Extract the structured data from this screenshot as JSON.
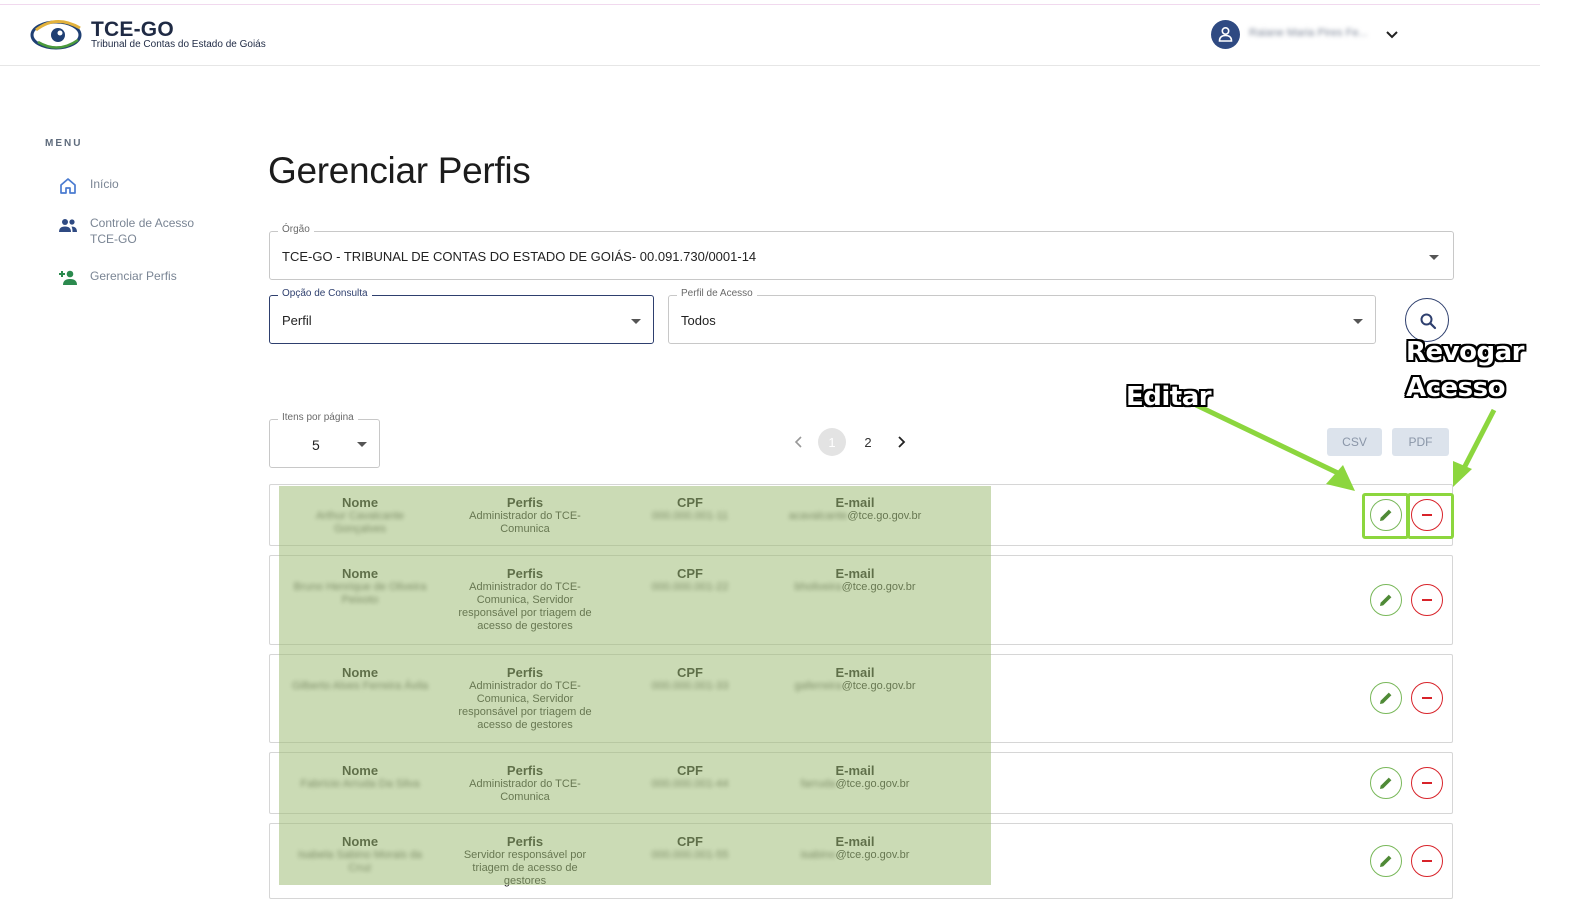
{
  "header": {
    "brand_title": "TCE-GO",
    "brand_subtitle": "Tribunal de Contas do Estado de Goiás",
    "user_name": "Raiane Maria Pires Fe..."
  },
  "menu": {
    "title": "MENU",
    "items": [
      {
        "label": "Início",
        "icon": "home-icon"
      },
      {
        "label": "Controle de Acesso TCE-GO",
        "icon": "people-icon"
      },
      {
        "label": "Gerenciar Perfis",
        "icon": "person-add-icon"
      }
    ]
  },
  "page": {
    "title": "Gerenciar Perfis"
  },
  "filters": {
    "orgao": {
      "label": "Órgão",
      "value": "TCE-GO - TRIBUNAL DE CONTAS DO ESTADO DE GOIÁS- 00.091.730/0001-14"
    },
    "opcao": {
      "label": "Opção de Consulta",
      "value": "Perfil"
    },
    "perfil": {
      "label": "Perfil de Acesso",
      "value": "Todos"
    }
  },
  "pagination": {
    "items_label": "Itens por página",
    "items_value": "5",
    "pages": [
      "1",
      "2"
    ],
    "current": "1"
  },
  "export": {
    "csv": "CSV",
    "pdf": "PDF"
  },
  "columns": {
    "nome": "Nome",
    "perfis": "Perfis",
    "cpf": "CPF",
    "email": "E-mail"
  },
  "rows": [
    {
      "nome": "Arthur Cavalcante Gonçalves",
      "perfis": "Administrador do TCE-Comunica",
      "cpf": "000.000.001-11",
      "email_user": "acavalcante",
      "email_domain": "@tce.go.gov.br"
    },
    {
      "nome": "Bruno Henrique de Oliveira Peixoto",
      "perfis": "Administrador do TCE-Comunica, Servidor responsável por triagem de acesso de gestores",
      "cpf": "000.000.001-22",
      "email_user": "bholiveira",
      "email_domain": "@tce.go.gov.br"
    },
    {
      "nome": "Gilberto Alves Ferreira Ávila",
      "perfis": "Administrador do TCE-Comunica, Servidor responsável por triagem de acesso de gestores",
      "cpf": "000.000.001-33",
      "email_user": "gaferreira",
      "email_domain": "@tce.go.gov.br"
    },
    {
      "nome": "Fabrício Arruda Da Silva",
      "perfis": "Administrador do TCE-Comunica",
      "cpf": "000.000.001-44",
      "email_user": "farruda",
      "email_domain": "@tce.go.gov.br"
    },
    {
      "nome": "Isabela Sabino Morais da Cruz",
      "perfis": "Servidor responsável por triagem de acesso de gestores",
      "cpf": "000.000.001-55",
      "email_user": "isabino",
      "email_domain": "@tce.go.gov.br"
    }
  ],
  "annotations": {
    "edit": "Editar",
    "revoke_line1": "Revogar",
    "revoke_line2": "Acesso"
  },
  "colors": {
    "primary": "#2e3f6e",
    "edit": "#79b85a",
    "revoke": "#d8232a",
    "highlight": "#8cd63e"
  }
}
